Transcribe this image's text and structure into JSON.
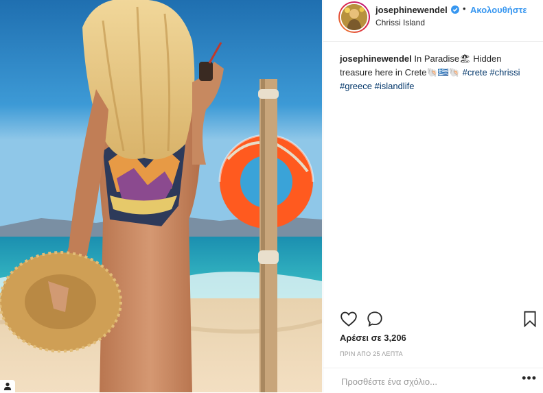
{
  "post": {
    "username": "josephinewendel",
    "follow_label": "Ακολουθήστε",
    "dot": "•",
    "location": "Chrissi Island",
    "caption": {
      "username": "josephinewendel",
      "text_1": "In Paradise",
      "emoji_1": "🏖",
      "text_2": " Hidden treasure here in Crete",
      "emoji_2": "🐚🇬🇷🐚",
      "hashtags": [
        "#crete",
        "#chrissi",
        "#greece",
        "#islandlife"
      ]
    },
    "likes": "Αρέσει σε 3,206",
    "time": "ΠΡΙΝ ΑΠΟ 25 ΛΕΠΤΑ",
    "comment_placeholder": "Προσθέστε ένα σχόλιο...",
    "more_label": "•••"
  },
  "icons": {
    "verified": "verified-badge-icon",
    "like": "heart-icon",
    "comment": "comment-icon",
    "save": "bookmark-icon",
    "user_tag": "user-tag-icon"
  },
  "colors": {
    "accent": "#3897f0",
    "text": "#262626",
    "muted": "#999999",
    "hashtag": "#003569",
    "divider": "#efefef"
  }
}
